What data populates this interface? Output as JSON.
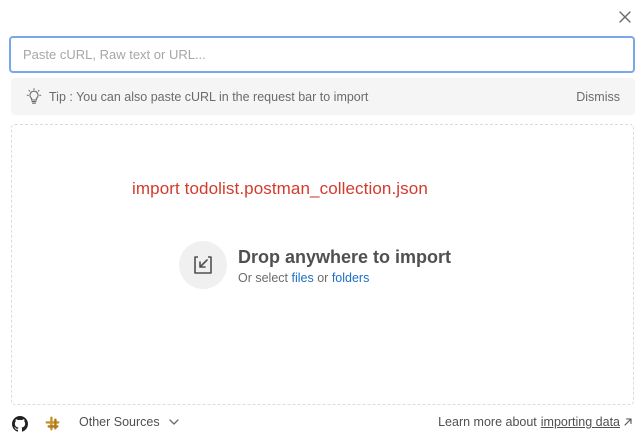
{
  "dialog": {
    "input": {
      "placeholder": "Paste cURL, Raw text or URL...",
      "value": ""
    },
    "tip": {
      "text": "Tip : You can also paste cURL in the request bar to import",
      "dismiss_label": "Dismiss"
    },
    "drop_zone": {
      "annotation": "import todolist.postman_collection.json",
      "title": "Drop anywhere to import",
      "subtitle_prefix": "Or select",
      "files_link": "files",
      "or_text": "or",
      "folders_link": "folders"
    },
    "footer": {
      "other_sources_label": "Other Sources",
      "learn_more_prefix": "Learn more about",
      "learn_more_link": "importing data"
    }
  }
}
